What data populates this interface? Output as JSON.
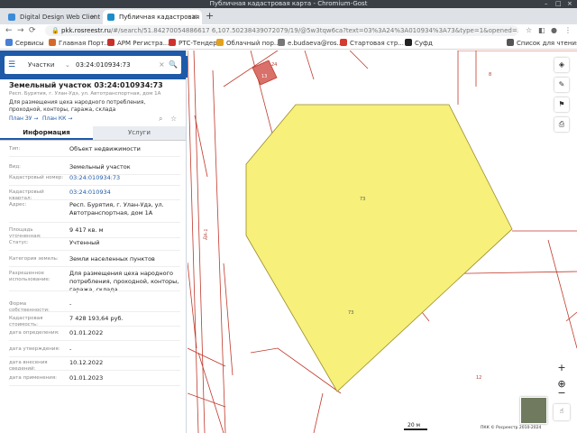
{
  "window": {
    "title": "Публичная кадастровая карта - Chromium-Gost",
    "controls": [
      "–",
      "□",
      "×"
    ]
  },
  "browser": {
    "tabs": [
      {
        "label": "Digital Design Web Client",
        "active": false,
        "icon_color": "#3c8bd9"
      },
      {
        "label": "Публичная кадастровая",
        "active": true,
        "icon_color": "#1e8cc6"
      }
    ],
    "new_tab": "+",
    "address_host": "pkk.rosreestr.ru",
    "address_path": "/#/search/51.84270054886617 6,107.50238439072079/19/@5w3tqw6ca?text=03%3A24%3A010934%3A73&type=1&opened=3...",
    "bookmarks": [
      {
        "label": "Сервисы",
        "icon_color": "#4a7fd6"
      },
      {
        "label": "Главная Порт...",
        "icon_color": "#d46a2a"
      },
      {
        "label": "АРМ Регистра...",
        "icon_color": "#c9302c"
      },
      {
        "label": "РТС-Тендер",
        "icon_color": "#d0312d"
      },
      {
        "label": "Облачный пор...",
        "icon_color": "#e4a11b"
      },
      {
        "label": "e.budaeva@ros...",
        "icon_color": "#777777"
      },
      {
        "label": "Стартовая стр...",
        "icon_color": "#d23b2e"
      },
      {
        "label": "Суфд",
        "icon_color": "#222222"
      },
      {
        "label": "Список для чтения",
        "icon_color": "#555555"
      }
    ]
  },
  "search": {
    "type_label": "Участки",
    "query": "03:24:010934:73"
  },
  "object": {
    "title": "Земельный участок 03:24:010934:73",
    "address_short": "Респ. Бурятия, г. Улан-Удэ, ул. Автотранспортная, дом 1А",
    "use_short": "Для размещения цеха народного потребления, проходной, конторы, гаража, склада",
    "plan_zu": "План ЗУ →",
    "plan_kk": "План КК →"
  },
  "panel_tabs": {
    "info": "Информация",
    "services": "Услуги"
  },
  "attributes": [
    {
      "label": "Тип:",
      "value": "Объект недвижимости",
      "link": false
    },
    {
      "label": "Вид:",
      "value": "Земельный участок",
      "link": false
    },
    {
      "label": "Кадастровый номер:",
      "value": "03:24:010934:73",
      "link": true
    },
    {
      "label": "Кадастровый квартал:",
      "value": "03:24:010934",
      "link": true
    },
    {
      "label": "Адрес:",
      "value": "Респ. Бурятия, г. Улан-Удэ, ул. Автотранспортная, дом 1А",
      "link": false
    },
    {
      "label": "Площадь уточненная:",
      "value": "9 417 кв. м",
      "link": false
    },
    {
      "label": "Статус:",
      "value": "Учтенный",
      "link": false
    },
    {
      "label": "Категория земель:",
      "value": "Земли населенных пунктов",
      "link": false
    },
    {
      "label": "Разрешенное использование:",
      "value": "Для размещения цеха народного потребления, проходной, конторы, гаража, склада",
      "link": false
    },
    {
      "label": "Форма собственности:",
      "value": "-",
      "link": false
    },
    {
      "label": "Кадастровая стоимость:",
      "value": "7 428 193,64 руб.",
      "link": false
    },
    {
      "label": "дата определения:",
      "value": "01.01.2022",
      "link": false
    },
    {
      "label": "дата утверждения:",
      "value": "-",
      "link": false
    },
    {
      "label": "дата внесения сведений:",
      "value": "10.12.2022",
      "link": false
    },
    {
      "label": "дата применения:",
      "value": "01.01.2023",
      "link": false
    }
  ],
  "map": {
    "parcel_fill": "#f7f07a",
    "parcel_stroke": "#9a8b2a",
    "boundary_color": "#c0392b",
    "labels": {
      "parcel_center": "73",
      "parcel_lower": "73",
      "top_24": "24",
      "red_box": "13",
      "top_right_8": "8",
      "right_12": "12",
      "road_label": "ДА-1"
    },
    "scale_label": "20 м",
    "copyright": "ПКК © Росреестр 2010-2024"
  }
}
